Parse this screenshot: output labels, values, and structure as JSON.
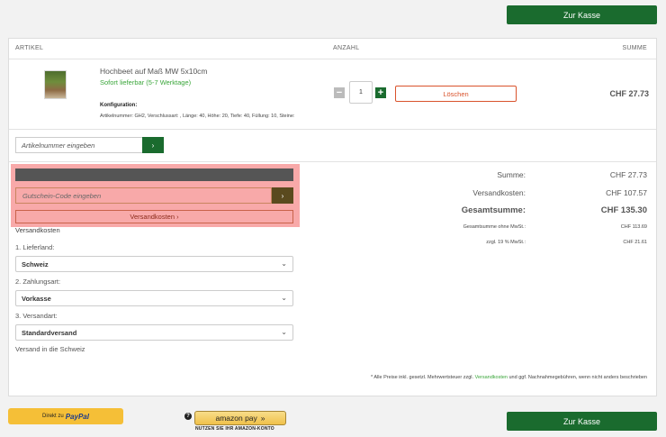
{
  "checkout_label": "Zur Kasse",
  "table_headers": {
    "article": "ARTIKEL",
    "quantity": "ANZAHL",
    "sum": "SUMME"
  },
  "item": {
    "name": "Hochbeet auf Maß MW 5x10cm",
    "availability": "Sofort lieferbar (5-7 Werktage)",
    "config_title": "Konfiguration:",
    "config_text": "Artikelnummer: GH2, Verschlussart: , Länge: 40, Höhe: 20, Tiefe: 40, Füllung: 10, Steine:",
    "quantity": "1",
    "delete_label": "Löschen",
    "price": "CHF 27.73"
  },
  "article_input": {
    "placeholder": "Artikelnummer eingeben",
    "button": "›"
  },
  "coupon": {
    "placeholder": "Gutschein-Code eingeben",
    "button": "›"
  },
  "shipping_toggle": "Versandkosten ›",
  "shipping": {
    "title": "Versandkosten",
    "country_label": "1. Lieferland:",
    "country_value": "Schweiz",
    "payment_label": "2. Zahlungsart:",
    "payment_value": "Vorkasse",
    "method_label": "3. Versandart:",
    "method_value": "Standardversand",
    "note": "Versand in die Schweiz"
  },
  "summary": {
    "subtotal_label": "Summe:",
    "subtotal_value": "CHF 27.73",
    "shipping_label": "Versandkosten:",
    "shipping_value": "CHF 107.57",
    "total_label": "Gesamtsumme:",
    "total_value": "CHF 135.30",
    "net_label": "Gesamtsumme ohne MwSt.:",
    "net_value": "CHF 113.69",
    "vat_label": "zzgl. 19 % MwSt.:",
    "vat_value": "CHF 21.61"
  },
  "footnote": {
    "prefix": "* Alle Preise inkl. gesetzl. Mehrwertsteuer zzgl.",
    "link": "Versandkosten",
    "suffix": "und ggf. Nachnahmegebühren, wenn nicht anders beschrieben"
  },
  "paypal": {
    "prefix": "Direkt zu",
    "brand": "PayPal"
  },
  "amazon": {
    "help": "?",
    "label": "amazon pay",
    "sub": "NUTZEN SIE IHR AMAZON-KONTO"
  },
  "colors": {
    "green": "#1a6b2e",
    "availability_green": "#3aa63a",
    "delete_red": "#d9532c",
    "highlight": "#f8a9a9"
  }
}
